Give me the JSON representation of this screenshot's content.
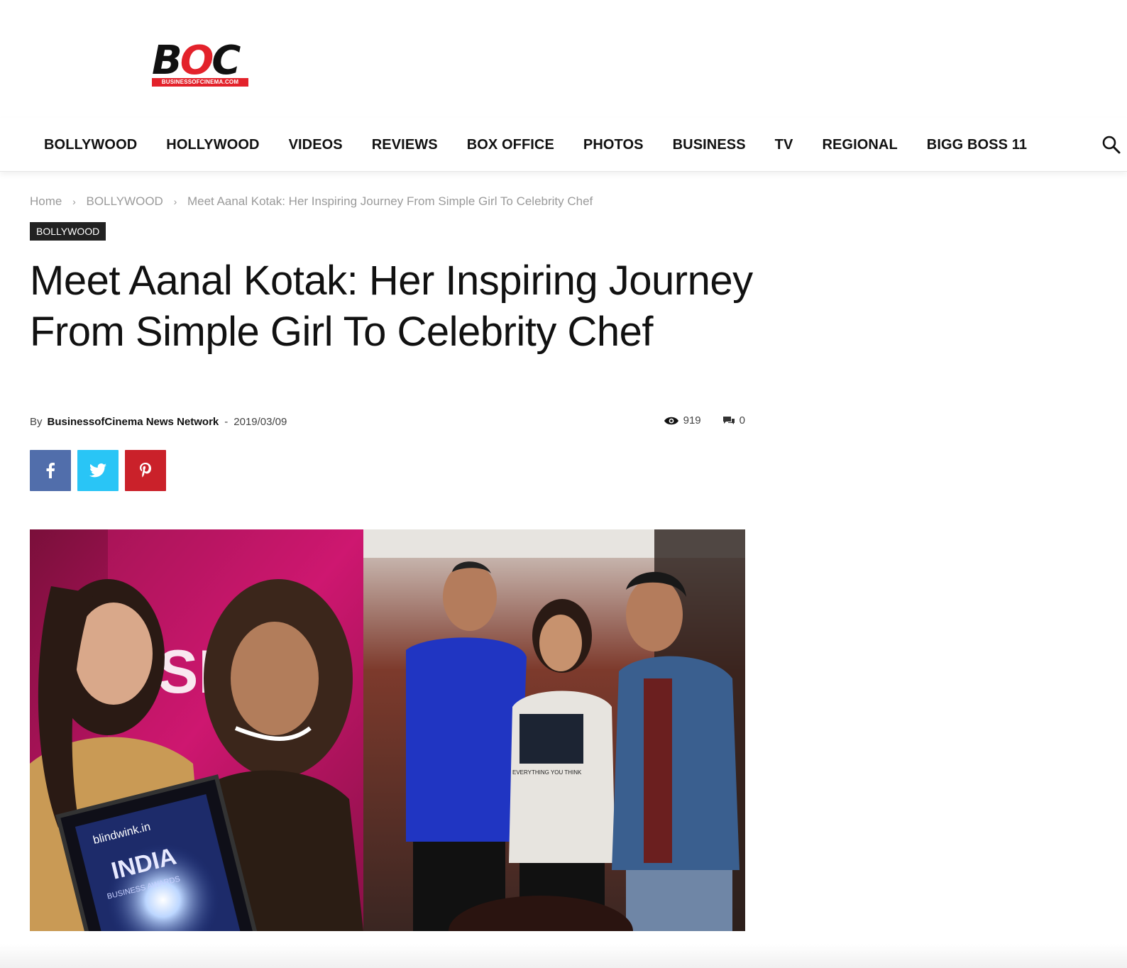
{
  "logo": {
    "main_b": "B",
    "main_o": "O",
    "main_c": "C",
    "sub": "BUSINESSOFCINEMA.COM",
    "accent_color": "#e3222b"
  },
  "nav": {
    "items": [
      "BOLLYWOOD",
      "HOLLYWOOD",
      "VIDEOS",
      "REVIEWS",
      "BOX OFFICE",
      "PHOTOS",
      "BUSINESS",
      "TV",
      "REGIONAL",
      "BIGG BOSS 11"
    ],
    "search_icon": "search-icon"
  },
  "breadcrumb": {
    "home": "Home",
    "category": "BOLLYWOOD",
    "current": "Meet Aanal Kotak: Her Inspiring Journey From Simple Girl To Celebrity Chef"
  },
  "article": {
    "category_tag": "BOLLYWOOD",
    "title": "Meet Aanal Kotak: Her Inspiring Journey From Simple Girl To Celebrity Chef",
    "by_label": "By",
    "author": "BusinessofCinema News Network",
    "date_separator": "-",
    "date": "2019/03/09",
    "views": "919",
    "comments": "0"
  },
  "share": {
    "facebook_color": "#516eab",
    "twitter_color": "#29c5f6",
    "pinterest_color": "#ca212a"
  },
  "featured_image": {
    "award_text": "blindwink.in",
    "award_title": "INDIA",
    "award_subtitle": "BUSINESS AWARDS",
    "backdrop_text": "SI",
    "shirt_text": "EVERYTHING YOU THINK"
  }
}
